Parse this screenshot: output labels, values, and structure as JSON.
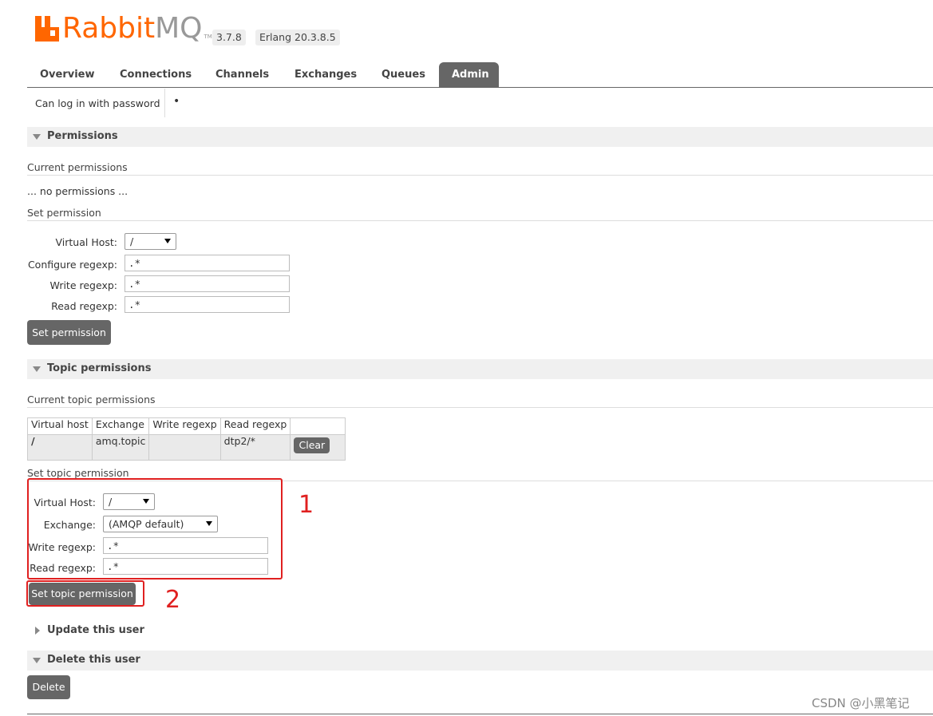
{
  "app": {
    "logo_text_a": "Rabbit",
    "logo_text_b": "MQ",
    "logo_tm": "TM",
    "version": "3.7.8",
    "erlang": "Erlang 20.3.8.5"
  },
  "tabs": [
    {
      "label": "Overview"
    },
    {
      "label": "Connections"
    },
    {
      "label": "Channels"
    },
    {
      "label": "Exchanges"
    },
    {
      "label": "Queues"
    },
    {
      "label": "Admin",
      "active": true
    }
  ],
  "user_info": {
    "login_label": "Can log in with password",
    "login_value": "•"
  },
  "permissions": {
    "title": "Permissions",
    "current_label": "Current permissions",
    "none_text": "... no permissions ...",
    "set_label": "Set permission",
    "form": {
      "vhost_label": "Virtual Host:",
      "vhost_value": "/",
      "configure_label": "Configure regexp:",
      "configure_value": ".*",
      "write_label": "Write regexp:",
      "write_value": ".*",
      "read_label": "Read regexp:",
      "read_value": ".*"
    },
    "submit_label": "Set permission"
  },
  "topic_permissions": {
    "title": "Topic permissions",
    "current_label": "Current topic permissions",
    "table": {
      "headers": [
        "Virtual host",
        "Exchange",
        "Write regexp",
        "Read regexp",
        ""
      ],
      "rows": [
        {
          "vhost": "/",
          "exchange": "amq.topic",
          "write": "",
          "read": "dtp2/*",
          "action": "Clear"
        }
      ]
    },
    "set_label": "Set topic permission",
    "form": {
      "vhost_label": "Virtual Host:",
      "vhost_value": "/",
      "exchange_label": "Exchange:",
      "exchange_value": "(AMQP default)",
      "write_label": "Write regexp:",
      "write_value": ".*",
      "read_label": "Read regexp:",
      "read_value": ".*"
    },
    "submit_label": "Set topic permission"
  },
  "annotations": {
    "mark1": "1",
    "mark2": "2",
    "color": "#e02020"
  },
  "update_user": {
    "title": "Update this user"
  },
  "delete_user": {
    "title": "Delete this user",
    "button": "Delete"
  },
  "watermark": "CSDN @小黑笔记"
}
